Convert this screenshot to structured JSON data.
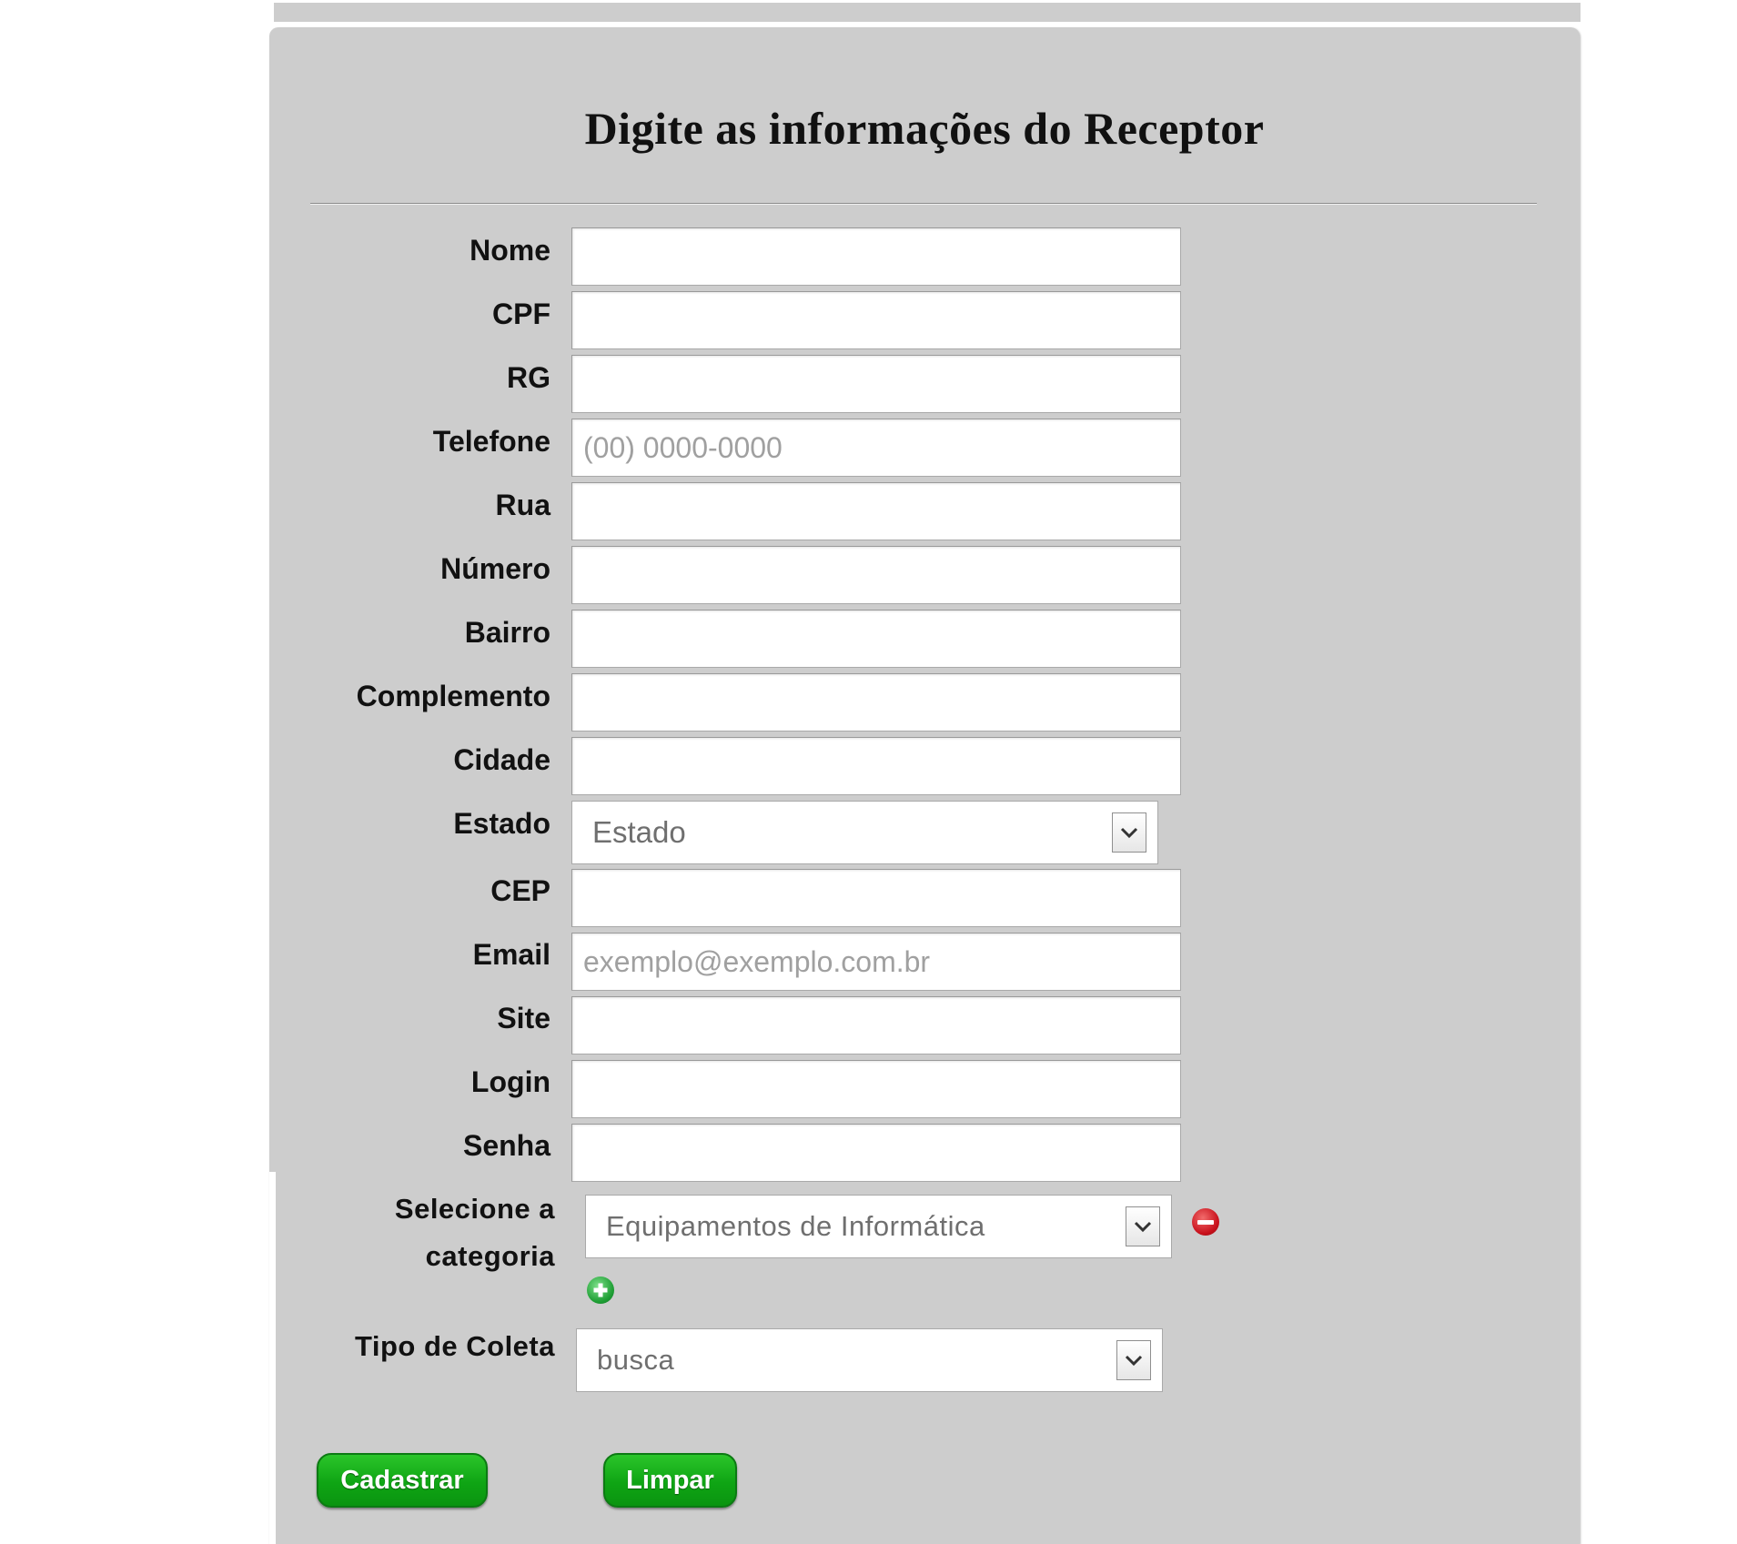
{
  "header": {
    "title": "Digite as informações do Receptor"
  },
  "form": {
    "fields": [
      {
        "label": "Nome",
        "value": "",
        "placeholder": ""
      },
      {
        "label": "CPF",
        "value": "",
        "placeholder": ""
      },
      {
        "label": "RG",
        "value": "",
        "placeholder": ""
      },
      {
        "label": "Telefone",
        "value": "",
        "placeholder": "(00) 0000-0000"
      },
      {
        "label": "Rua",
        "value": "",
        "placeholder": ""
      },
      {
        "label": "Número",
        "value": "",
        "placeholder": ""
      },
      {
        "label": "Bairro",
        "value": "",
        "placeholder": ""
      },
      {
        "label": "Complemento",
        "value": "",
        "placeholder": ""
      },
      {
        "label": "Cidade",
        "value": "",
        "placeholder": ""
      }
    ],
    "estado": {
      "label": "Estado",
      "selected": "Estado"
    },
    "fields2": [
      {
        "label": "CEP",
        "value": "",
        "placeholder": ""
      },
      {
        "label": "Email",
        "value": "",
        "placeholder": "exemplo@exemplo.com.br"
      },
      {
        "label": "Site",
        "value": "",
        "placeholder": ""
      },
      {
        "label": "Login",
        "value": "",
        "placeholder": ""
      },
      {
        "label": "Senha",
        "value": "",
        "placeholder": ""
      }
    ],
    "categoria": {
      "label_line1": "Selecione a",
      "label_line2": "categoria",
      "selected": "Equipamentos de Informática",
      "remove_icon": "minus-circle-icon",
      "add_icon": "plus-circle-icon"
    },
    "tipo_coleta": {
      "label": "Tipo de Coleta",
      "selected": "busca"
    }
  },
  "buttons": {
    "submit_label": "Cadastrar",
    "clear_label": "Limpar"
  },
  "colors": {
    "panel_bg": "#cdcdcd",
    "button_green": "#0fa514",
    "remove_red": "#d2202b",
    "add_green": "#22a63a"
  }
}
